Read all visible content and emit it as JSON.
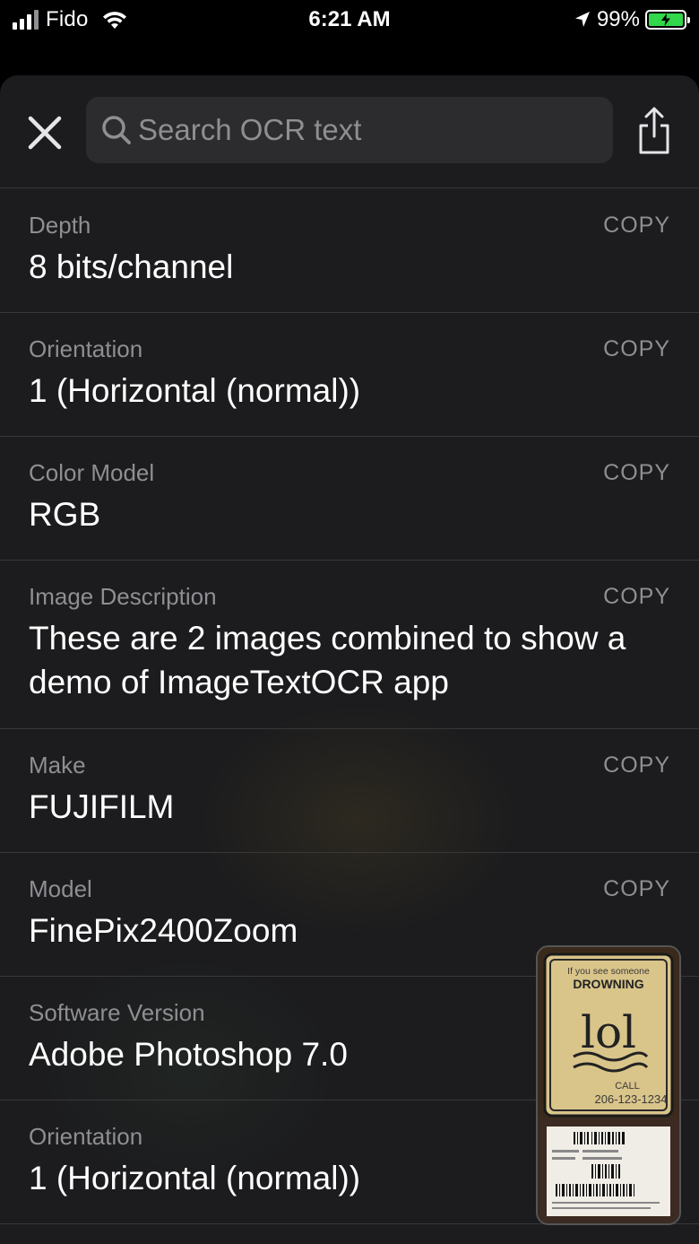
{
  "status_bar": {
    "carrier": "Fido",
    "time": "6:21 AM",
    "battery": "99%",
    "battery_color": "#32d74b"
  },
  "toolbar": {
    "search": {
      "placeholder": "Search OCR text",
      "value": ""
    },
    "icons": [
      "close-icon",
      "search-icon",
      "share-icon"
    ]
  },
  "metadata": [
    {
      "label": "Depth",
      "value": "8 bits/channel",
      "copy": "COPY"
    },
    {
      "label": "Orientation",
      "value": "1 (Horizontal (normal))",
      "copy": "COPY"
    },
    {
      "label": "Color Model",
      "value": "RGB",
      "copy": "COPY"
    },
    {
      "label": "Image Description",
      "value": "These are 2 images combined to show a demo of ImageTextOCR app",
      "copy": "COPY"
    },
    {
      "label": "Make",
      "value": "FUJIFILM",
      "copy": "COPY"
    },
    {
      "label": "Model",
      "value": "FinePix2400Zoom",
      "copy": "COPY"
    },
    {
      "label": "Software Version",
      "value": "Adobe Photoshop 7.0",
      "copy": ""
    },
    {
      "label": "Orientation",
      "value": "1 (Horizontal (normal))",
      "copy": ""
    }
  ],
  "thumbnail": {
    "sign_top": "If you see someone",
    "sign_title": "DROWNING",
    "sign_big": "lol",
    "sign_call": "CALL",
    "sign_phone": "206-123-1234"
  }
}
